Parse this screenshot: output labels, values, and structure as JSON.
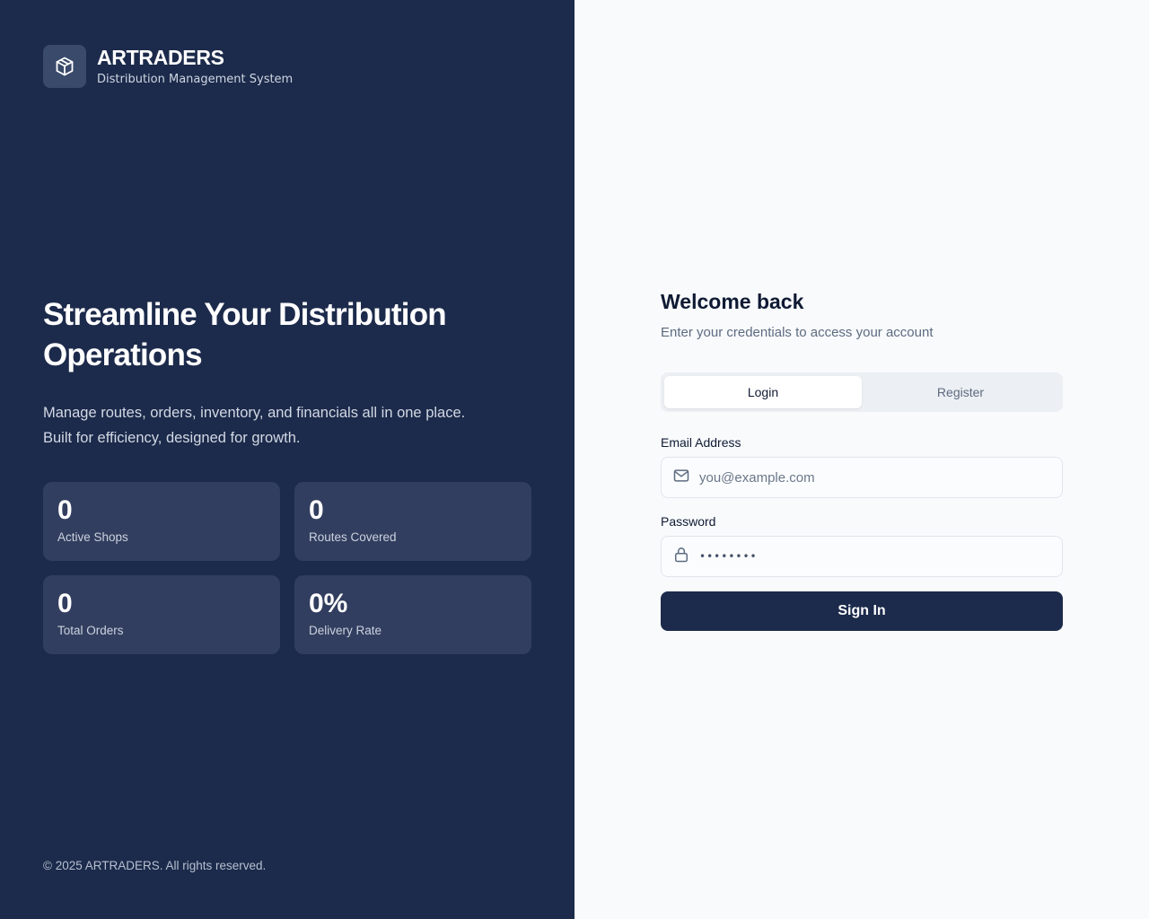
{
  "brand": {
    "name": "ARTRADERS",
    "subtitle": "Distribution Management System",
    "logo_icon": "package-box-icon"
  },
  "hero": {
    "title_line1": "Streamline Your Distribution",
    "title_line2": "Operations",
    "desc_line1": "Manage routes, orders, inventory, and financials all in one place.",
    "desc_line2": "Built for efficiency, designed for growth."
  },
  "stats": [
    {
      "value": "0",
      "label": "Active Shops"
    },
    {
      "value": "0",
      "label": "Routes Covered"
    },
    {
      "value": "0",
      "label": "Total Orders"
    },
    {
      "value": "0%",
      "label": "Delivery Rate"
    }
  ],
  "footer": {
    "text": "© 2025 ARTRADERS. All rights reserved."
  },
  "form": {
    "title": "Welcome back",
    "subtitle": "Enter your credentials to access your account",
    "tabs": [
      {
        "label": "Login",
        "active": true
      },
      {
        "label": "Register",
        "active": false
      }
    ],
    "email": {
      "label": "Email Address",
      "placeholder": "you@example.com",
      "value": ""
    },
    "password": {
      "label": "Password",
      "masked_value": "••••••••"
    },
    "submit_label": "Sign In"
  },
  "colors": {
    "left_bg": "#1c2a4b",
    "card_bg": "#323e5f",
    "right_bg": "#f8fafc",
    "primary_button": "#1c2a4b"
  }
}
